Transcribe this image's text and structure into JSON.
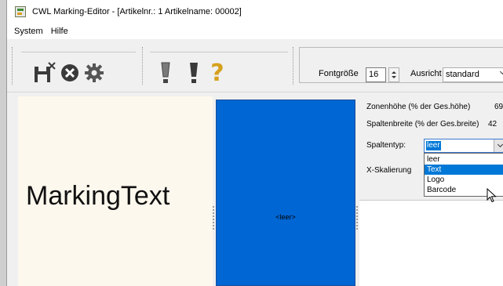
{
  "window": {
    "title": "CWL Marking-Editor - [Artikelnr.: 1   Artikelname: 00002]"
  },
  "menu": {
    "items": [
      "System",
      "Hilfe"
    ]
  },
  "toolbar": {
    "exclamation_1": "!",
    "exclamation_2": "!",
    "question": "?",
    "font_size_label": "Fontgröße",
    "font_size_value": "16",
    "alignment_label": "Ausricht",
    "alignment_value": "standard"
  },
  "canvas": {
    "marking_text": "MarkingText",
    "empty_label": "<leer>",
    "column_color": "#0066d4",
    "zone_bg": "#fdf8ed"
  },
  "properties": {
    "zone_height_label": "Zonenhöhe (% der Ges.höhe)",
    "zone_height_value": "69",
    "column_width_label": "Spaltenbreite (% der Ges.breite)",
    "column_width_value": "42",
    "column_type_label": "Spaltentyp:",
    "column_type_value": "leer",
    "x_scale_label": "X-Skalierung",
    "column_type_options": [
      "leer",
      "Text",
      "Logo",
      "Barcode"
    ],
    "highlighted_option": "Text"
  }
}
